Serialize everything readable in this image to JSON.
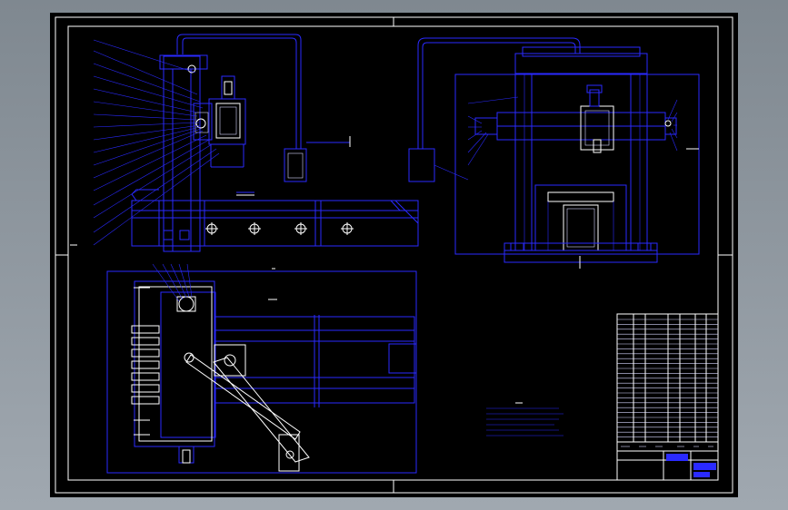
{
  "drawing": {
    "background": "#000000",
    "line_color": "#2a2aff",
    "frame_color": "#ffffff",
    "views": [
      "front-view",
      "side-view",
      "top-view"
    ],
    "icons": [
      "cross-circle-icon",
      "motor-icon"
    ]
  },
  "title_block": {
    "colors": {
      "highlight": "#2a2aff"
    }
  }
}
